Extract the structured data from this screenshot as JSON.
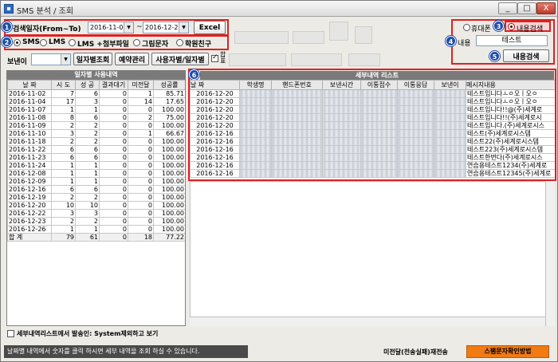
{
  "window": {
    "title": "SMS 분석 / 조회",
    "minimize": "_",
    "maximize": "□",
    "close": "X"
  },
  "search": {
    "badge1": "1",
    "date_label": "검색일자(From~To)",
    "from": "2016-11-01",
    "tilde": "~",
    "to": "2016-12-27",
    "excel_button": "Excel"
  },
  "types": {
    "badge2": "2",
    "options": [
      "SMS",
      "LMS",
      "LMS +첨부파일",
      "그림문자",
      "학원친구"
    ],
    "selected": "SMS"
  },
  "toolbar": {
    "sender_label": "보낸이",
    "daily_button": "일자별조회",
    "reserve_button": "예약관리",
    "user_date_button": "사용자별/일자별",
    "check_label": "합 표"
  },
  "content_search": {
    "badge3": "3",
    "badge4": "4",
    "badge5": "5",
    "radio_phone": "휴대폰",
    "radio_content": "내용검색",
    "content_label": "내용",
    "content_value": "테스트",
    "search_button": "내용검색"
  },
  "daily": {
    "title": "일자별 사용내역",
    "columns": [
      "날 짜",
      "시 도",
      "성 공",
      "결과대기",
      "미전달",
      "성공률"
    ],
    "rows": [
      [
        "2016-11-02",
        "7",
        "6",
        "0",
        "1",
        "85.71"
      ],
      [
        "2016-11-04",
        "17",
        "3",
        "0",
        "14",
        "17.65"
      ],
      [
        "2016-11-07",
        "1",
        "1",
        "0",
        "0",
        "100.00"
      ],
      [
        "2016-11-08",
        "8",
        "6",
        "0",
        "2",
        "75.00"
      ],
      [
        "2016-11-09",
        "2",
        "2",
        "0",
        "0",
        "100.00"
      ],
      [
        "2016-11-10",
        "3",
        "2",
        "0",
        "1",
        "66.67"
      ],
      [
        "2016-11-18",
        "2",
        "2",
        "0",
        "0",
        "100.00"
      ],
      [
        "2016-11-22",
        "6",
        "6",
        "0",
        "0",
        "100.00"
      ],
      [
        "2016-11-23",
        "6",
        "6",
        "0",
        "0",
        "100.00"
      ],
      [
        "2016-11-24",
        "1",
        "1",
        "0",
        "0",
        "100.00"
      ],
      [
        "2016-12-08",
        "1",
        "1",
        "0",
        "0",
        "100.00"
      ],
      [
        "2016-12-09",
        "1",
        "1",
        "0",
        "0",
        "100.00"
      ],
      [
        "2016-12-16",
        "6",
        "6",
        "0",
        "0",
        "100.00"
      ],
      [
        "2016-12-19",
        "2",
        "2",
        "0",
        "0",
        "100.00"
      ],
      [
        "2016-12-20",
        "10",
        "10",
        "0",
        "0",
        "100.00"
      ],
      [
        "2016-12-22",
        "3",
        "3",
        "0",
        "0",
        "100.00"
      ],
      [
        "2016-12-23",
        "2",
        "2",
        "0",
        "0",
        "100.00"
      ],
      [
        "2016-12-26",
        "1",
        "1",
        "0",
        "0",
        "100.00"
      ]
    ],
    "total": [
      "합 계",
      "79",
      "61",
      "0",
      "18",
      "77.22"
    ]
  },
  "detail": {
    "badge6": "6",
    "title": "세부내역 리스트",
    "columns": [
      "날 짜",
      "학생명",
      "핸드폰번호",
      "보낸시간",
      "이통접수",
      "이통응답",
      "보낸이",
      "메시지내용"
    ],
    "rows": [
      [
        "2016-12-20",
        "테스트입니다ㅗㅇ오ㅣ오ㅇ"
      ],
      [
        "2016-12-20",
        "테스트입니다ㅗㅇ오ㅣ오ㅇ"
      ],
      [
        "2016-12-20",
        "테스트입니다!!@(주)세계로"
      ],
      [
        "2016-12-20",
        "테스트입니다!!(주)세계로시"
      ],
      [
        "2016-12-20",
        "테스트입니다.(주)세계로시스"
      ],
      [
        "2016-12-16",
        "테스트(주)세계로시스템"
      ],
      [
        "2016-12-16",
        "테스트22(주)세계로시스템"
      ],
      [
        "2016-12-16",
        "테스트223(주)세계로시스템"
      ],
      [
        "2016-12-16",
        "테스트한번다(주)세계로시스"
      ],
      [
        "2016-12-16",
        "연습용테스트1234(주)세계로"
      ],
      [
        "2016-12-16",
        "연습용테스트12345(주)세계로"
      ]
    ]
  },
  "bottom": {
    "check_label": "세부내역리스트에서 발송인: System제외하고 보기"
  },
  "status": {
    "message": "날짜별 내역에서 숫자를 클릭 하시면 세부 내역을 조회 하실 수 있습니다.",
    "right_text": "미전달(전송실패)재전송",
    "orange_button": "스팸문자확인방법"
  },
  "colors": {
    "highlight": "#e02020",
    "badge": "#1e4ea8",
    "orange": "#f07a14"
  }
}
